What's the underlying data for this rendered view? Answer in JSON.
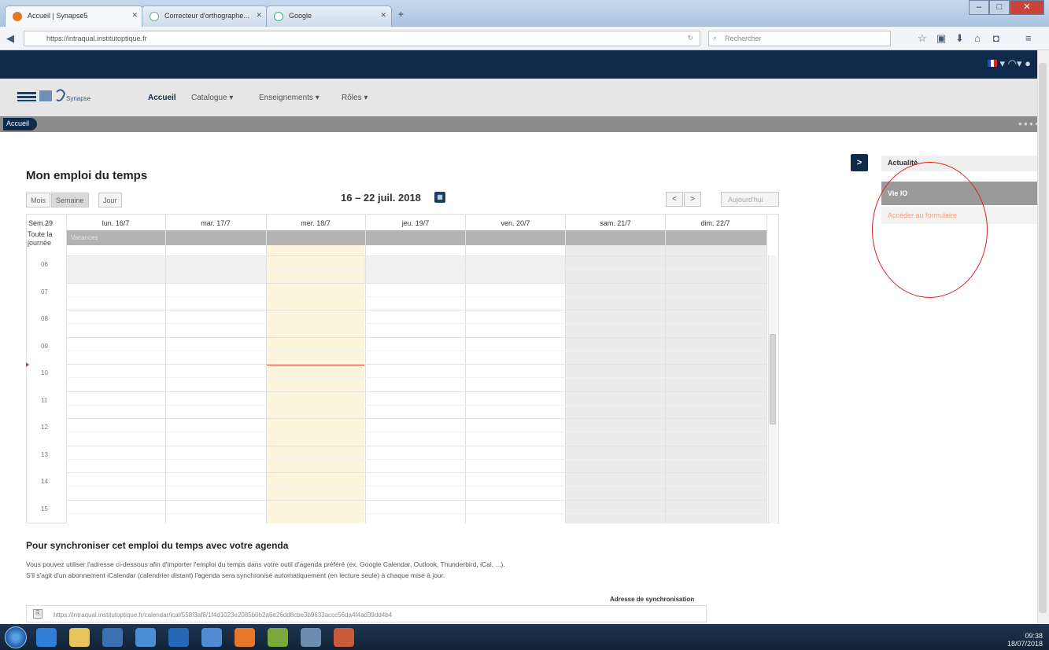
{
  "browser": {
    "tabs": [
      {
        "label": "Accueil | Synapse5",
        "fav_color": "#e07b2a"
      },
      {
        "label": "Correcteur d'orthographe...",
        "fav_color": "#ffffff"
      },
      {
        "label": "Google",
        "fav_color": "#ffffff"
      }
    ],
    "url": "https://intraqual.institutoptique.fr",
    "search_placeholder": "Rechercher"
  },
  "site": {
    "logo_text": "Synapse",
    "menu": [
      {
        "label": "Accueil"
      },
      {
        "label": "Catalogue ▾"
      },
      {
        "label": "Enseignements ▾"
      },
      {
        "label": "Rôles ▾"
      }
    ],
    "breadcrumb": "Accueil"
  },
  "schedule": {
    "title": "Mon emploi du temps",
    "views": [
      "Mois",
      "Semaine",
      "Jour"
    ],
    "date_range": "16 – 22 juil. 2018",
    "prev": "<",
    "next": ">",
    "today": "Aujourd'hui",
    "week_label": "Sem.29",
    "allday_label": "Toute la journée",
    "allday_event": "Vacances",
    "days": [
      "lun. 16/7",
      "mar. 17/7",
      "mer. 18/7",
      "jeu. 19/7",
      "ven. 20/7",
      "sam. 21/7",
      "dim. 22/7"
    ],
    "hours": [
      "06",
      "07",
      "08",
      "09",
      "10",
      "11",
      "12",
      "13",
      "14",
      "15"
    ]
  },
  "sync": {
    "title": "Pour synchroniser cet emploi du temps avec votre agenda",
    "line1": "Vous pouvez utiliser l'adresse ci-dessous afin d'importer l'emploi du temps dans votre outil d'agenda préféré (ex. Google Calendar, Outlook, Thunderbird, iCal, ...).",
    "line2": "S'il s'agit d'un abonnement iCalendar (calendrier distant) l'agenda sera synchronisé automatiquement (en lecture seule) à chaque mise à jour.",
    "label": "Adresse de synchronisation",
    "url": "https://intraqual.institutoptique.fr/calendar/ical/558f3af8/1f4d1023e2085b0b2a6e26dd8cbe3b9633accc56da4f4ad39dd4b4"
  },
  "sidebar": {
    "toggle": ">",
    "news_title": "Actualité",
    "news_category": "Vie IO",
    "news_link": "Accéder au formulaire"
  },
  "taskbar": {
    "time": "09:38",
    "date": "18/07/2018"
  }
}
